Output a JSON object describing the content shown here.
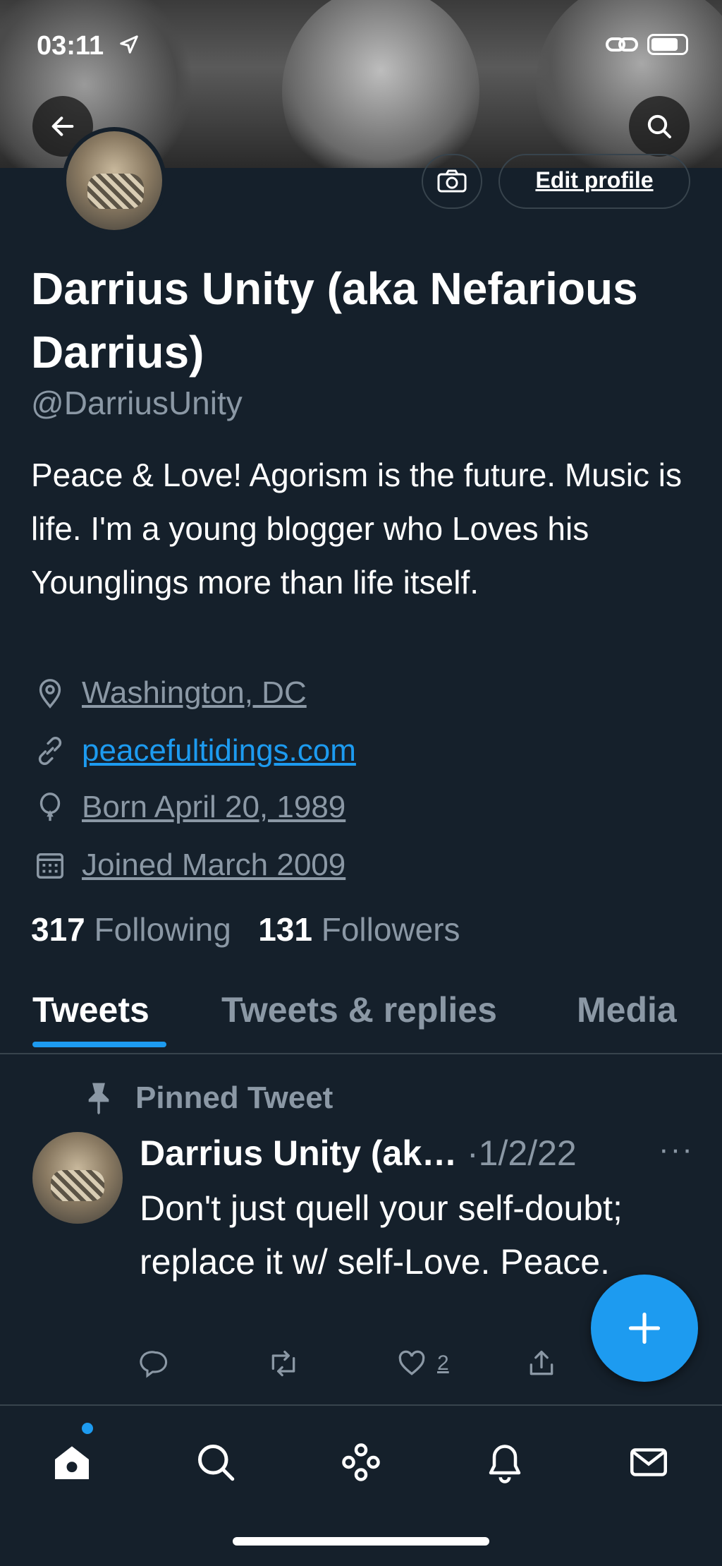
{
  "status_bar": {
    "time": "03:11"
  },
  "profile": {
    "edit_label": "Edit profile",
    "display_name": "Darrius Unity (aka Nefarious Darrius)",
    "handle": "@DarriusUnity",
    "bio": "Peace & Love! Agorism is the future. Music is life. I'm a young blogger who Loves his Younglings more than life itself.",
    "location": "Washington, DC",
    "website": "peacefultidings.com",
    "birthday": "Born April 20, 1989",
    "joined": "Joined March 2009",
    "following_count": "317",
    "following_label": "Following",
    "followers_count": "131",
    "followers_label": "Followers"
  },
  "tabs": [
    {
      "label": "Tweets",
      "active": true
    },
    {
      "label": "Tweets & replies",
      "active": false
    },
    {
      "label": "Media",
      "active": false
    }
  ],
  "pinned_tweet": {
    "pinned_label": "Pinned Tweet",
    "author": "Darrius Unity (ak…",
    "date": "·1/2/22",
    "more": "···",
    "text": "Don't just quell your self-doubt; replace it w/ self-Love. Peace.",
    "like_count": "2"
  },
  "colors": {
    "background": "#15202b",
    "accent": "#1d9bf0",
    "muted": "#8b98a5",
    "border": "#38444d"
  },
  "icons": {
    "back": "arrow-left-icon",
    "search": "search-icon",
    "camera": "camera-icon",
    "location": "location-pin-icon",
    "link": "link-icon",
    "birthday": "balloon-icon",
    "calendar": "calendar-icon",
    "pin": "pin-icon",
    "reply": "reply-icon",
    "retweet": "retweet-icon",
    "like": "heart-icon",
    "share": "share-icon",
    "compose": "plus-icon",
    "home": "home-icon",
    "spaces": "spaces-icon",
    "notifications": "bell-icon",
    "messages": "mail-icon"
  }
}
